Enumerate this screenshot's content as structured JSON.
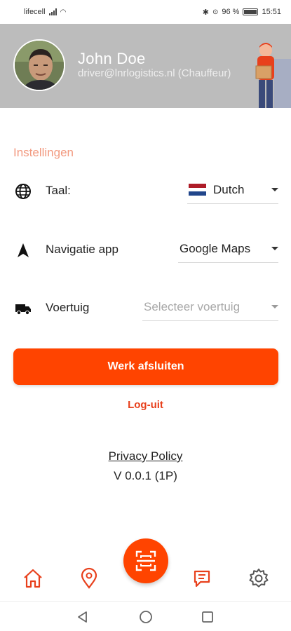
{
  "status_bar": {
    "carrier": "lifecell",
    "battery": "96 %",
    "time": "15:51"
  },
  "profile": {
    "name": "John Doe",
    "email_role": "driver@lnrlogistics.nl (Chauffeur)"
  },
  "settings": {
    "section_title": "Instellingen",
    "language": {
      "label": "Taal:",
      "value": "Dutch",
      "icon": "globe-icon"
    },
    "navigation": {
      "label": "Navigatie app",
      "value": "Google Maps",
      "icon": "navigation-arrow-icon"
    },
    "vehicle": {
      "label": "Voertuig",
      "placeholder": "Selecteer voertuig",
      "icon": "truck-icon"
    }
  },
  "actions": {
    "finish_work": "Werk afsluiten",
    "logout": "Log-uit"
  },
  "footer": {
    "privacy_policy": "Privacy Policy",
    "version": "V 0.0.1 (1P)"
  },
  "bottom_nav": [
    "home-icon",
    "map-pin-icon",
    "scan-icon",
    "chat-icon",
    "gear-icon"
  ],
  "colors": {
    "accent": "#ff4400",
    "header_bg": "#bcbcbc",
    "section_title": "#f29a80"
  }
}
